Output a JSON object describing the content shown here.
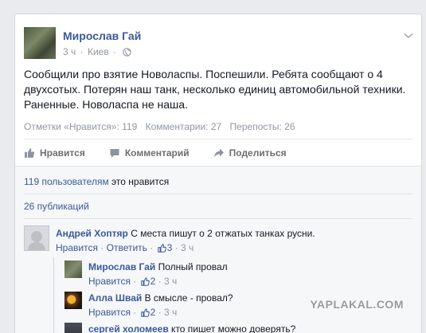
{
  "post": {
    "author": "Мирослав Гай",
    "time": "3 ч",
    "separator": "·",
    "location": "Киев",
    "location_sep": "·",
    "text": "Сообщили про взятие Новоласпы. Поспешили. Ребята сообщают о 4 двухсотых. Потерян наш танк, несколько единиц автомобильной техники. Раненные. Новоласпа не наша.",
    "stats": {
      "likes": "Отметки «Нравится»: 119",
      "comments": "Комментарии: 27",
      "shares": "Перепосты: 26"
    }
  },
  "actions": {
    "like": "Нравится",
    "comment": "Комментарий",
    "share": "Поделиться"
  },
  "likes_summary": {
    "link": "119 пользователям",
    "rest": " это нравится"
  },
  "shares_summary": "26 публикаций",
  "comments": [
    {
      "author": "Андрей Хоптяр",
      "text": " С места пишут о 2 отжатых танках русни.",
      "like_label": "Нравится",
      "sep1": " · ",
      "reply_label": "Ответить",
      "sep2": " · ",
      "like_count": "3",
      "sep3": " · ",
      "time": "3 ч"
    },
    {
      "author": "Мирослав Гай",
      "text": " Полный провал",
      "like_label": "Нравится",
      "sep1": " · ",
      "like_count": "2",
      "sep2": " · ",
      "time": "3 ч"
    },
    {
      "author": "Алла Швай",
      "text": " В смысле - провал?",
      "like_label": "Нравится",
      "sep1": " · ",
      "like_count": "2",
      "sep2": " · ",
      "time": "3 ч"
    },
    {
      "author": "сергей холомеев",
      "text": " кто пишет можно доверять?"
    }
  ],
  "watermark": "YAPLAKAL.COM",
  "icons": {
    "globe": "globe-icon",
    "chevron": "chevron-down-icon",
    "like": "thumbs-up-icon",
    "comment": "comment-icon",
    "share": "share-arrow-icon"
  },
  "colors": {
    "link": "#3b5998",
    "muted": "#9197a3",
    "text": "#141823",
    "background": "#e9ebee"
  }
}
